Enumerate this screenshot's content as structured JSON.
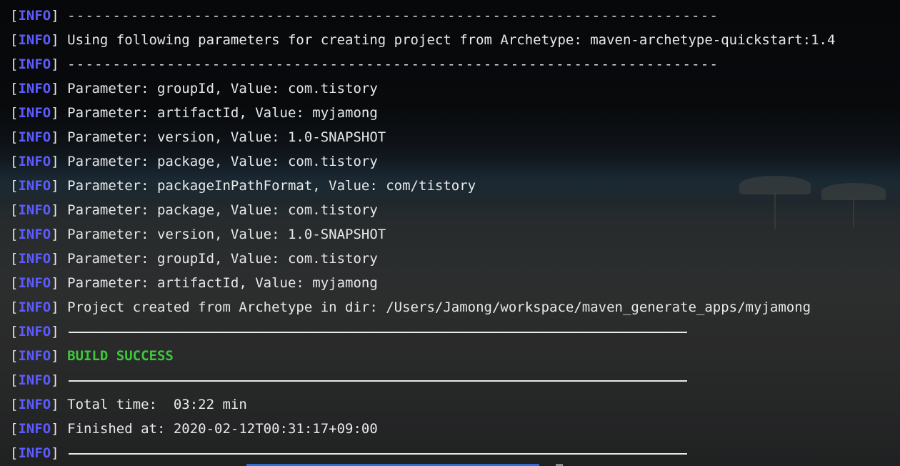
{
  "log_tag": "INFO",
  "bracket_open": "[",
  "bracket_close": "]",
  "dash_separator": "------------------------------------------------------------------------",
  "lines": [
    {
      "kind": "dash"
    },
    {
      "kind": "text",
      "text": "Using following parameters for creating project from Archetype: maven-archetype-quickstart:1.4"
    },
    {
      "kind": "dash"
    },
    {
      "kind": "text",
      "text": "Parameter: groupId, Value: com.tistory"
    },
    {
      "kind": "text",
      "text": "Parameter: artifactId, Value: myjamong"
    },
    {
      "kind": "text",
      "text": "Parameter: version, Value: 1.0-SNAPSHOT"
    },
    {
      "kind": "text",
      "text": "Parameter: package, Value: com.tistory"
    },
    {
      "kind": "text",
      "text": "Parameter: packageInPathFormat, Value: com/tistory"
    },
    {
      "kind": "text",
      "text": "Parameter: package, Value: com.tistory"
    },
    {
      "kind": "text",
      "text": "Parameter: version, Value: 1.0-SNAPSHOT"
    },
    {
      "kind": "text",
      "text": "Parameter: groupId, Value: com.tistory"
    },
    {
      "kind": "text",
      "text": "Parameter: artifactId, Value: myjamong"
    },
    {
      "kind": "text",
      "text": "Project created from Archetype in dir: /Users/Jamong/workspace/maven_generate_apps/myjamong"
    },
    {
      "kind": "rule"
    },
    {
      "kind": "success",
      "text": "BUILD SUCCESS"
    },
    {
      "kind": "rule"
    },
    {
      "kind": "text",
      "text": "Total time:  03:22 min"
    },
    {
      "kind": "text",
      "text": "Finished at: 2020-02-12T00:31:17+09:00"
    },
    {
      "kind": "rule"
    }
  ],
  "colors": {
    "tag": "#5b5bff",
    "text": "#e8e8e8",
    "success": "#3cc83c"
  }
}
